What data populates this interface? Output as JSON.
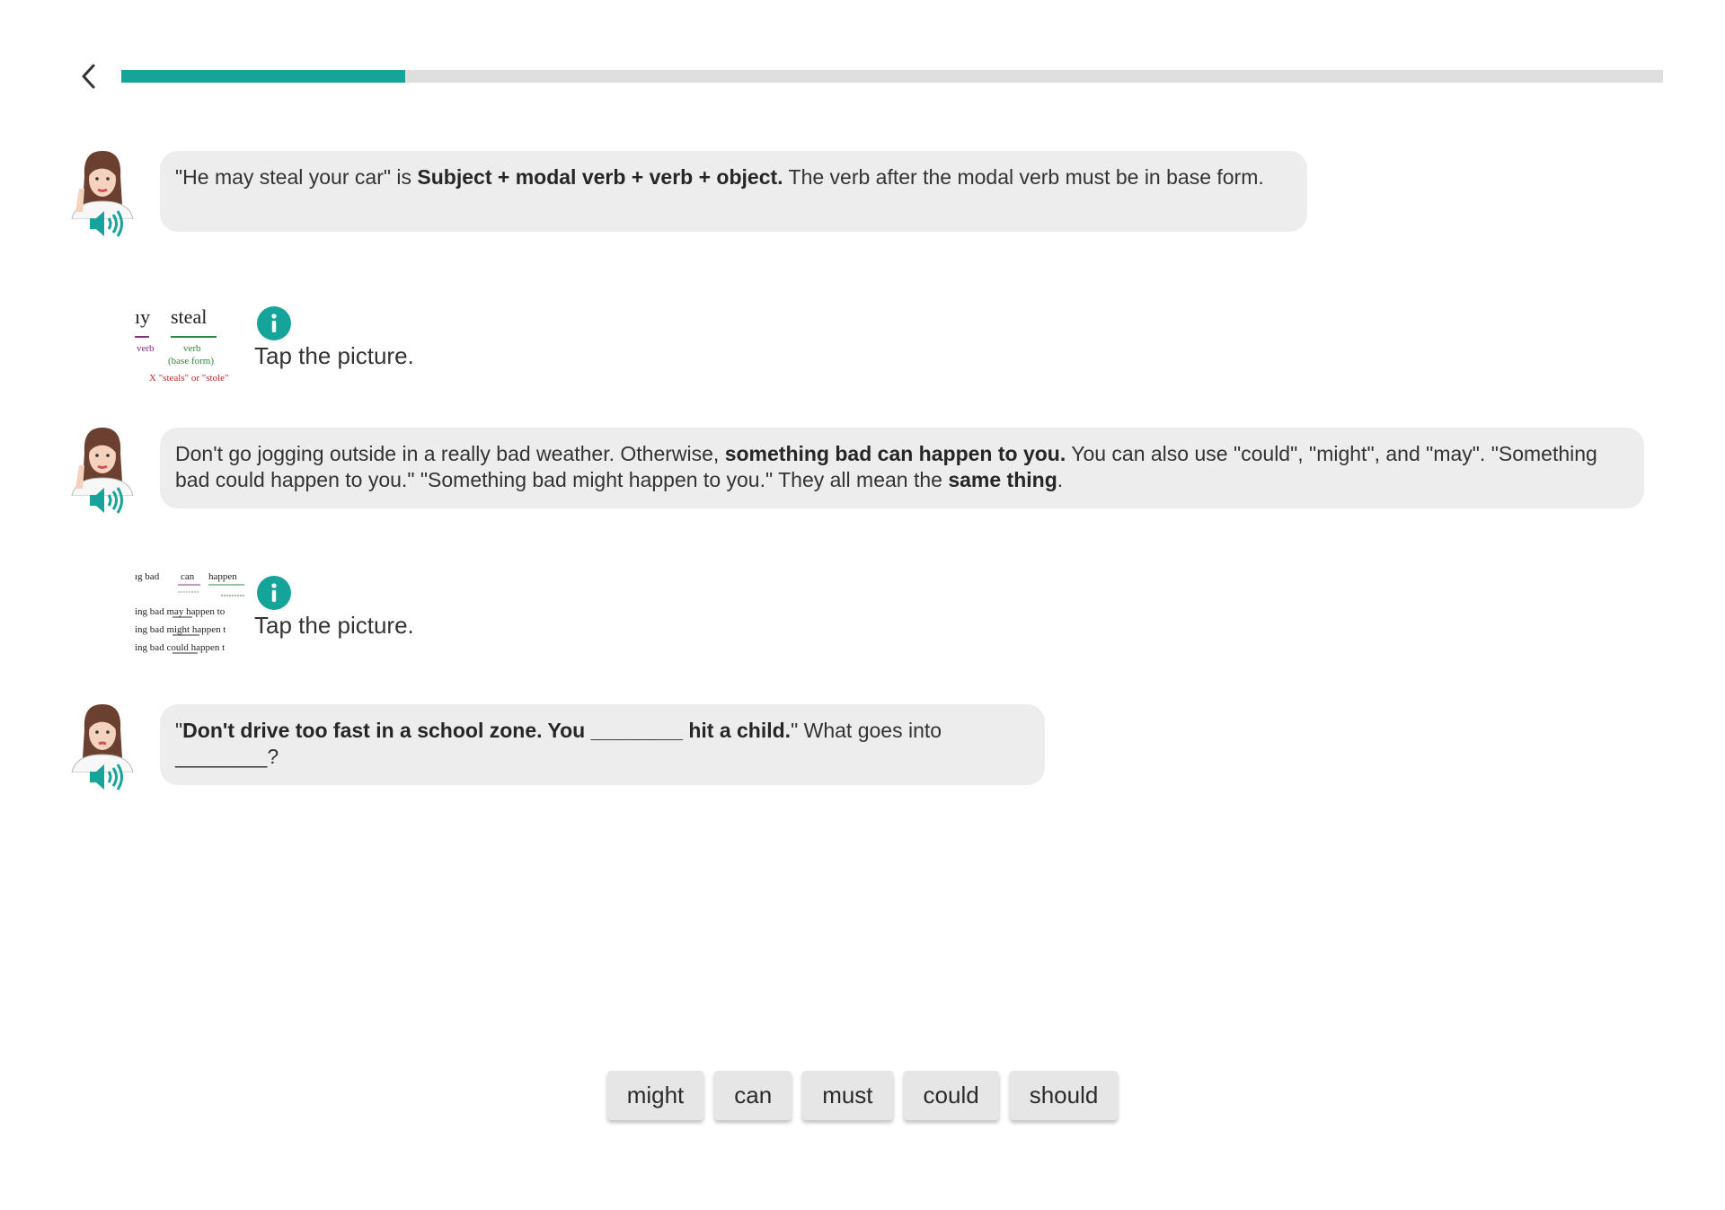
{
  "progress": {
    "fraction": 0.184
  },
  "colors": {
    "accent": "#15a39a",
    "bubble": "#ededed",
    "track": "#dedede"
  },
  "messages": [
    {
      "parts": [
        {
          "text": "\"He may steal your car\" is "
        },
        {
          "text": "Subject + modal verb + verb + object.",
          "bold": true
        },
        {
          "text": " The verb after the modal verb must be in base form."
        }
      ]
    },
    {
      "parts": [
        {
          "text": "Don't go jogging outside in a really bad weather. Otherwise, "
        },
        {
          "text": "something bad can happen to you.",
          "bold": true
        },
        {
          "text": " You can also use \"could\", \"might\", and \"may\". \"Something bad could happen to you.\" \"Something bad might happen to you.\" They all mean the "
        },
        {
          "text": "same thing",
          "bold": true
        },
        {
          "text": "."
        }
      ]
    },
    {
      "parts": [
        {
          "text": "\""
        },
        {
          "text": "Don't drive too fast in a school zone. You ________ hit a child.",
          "bold": true
        },
        {
          "text": "\" What goes into ________?"
        }
      ]
    }
  ],
  "pictures": [
    {
      "tap_text": "Tap the picture.",
      "thumb_labels": {
        "left_word": "ıy",
        "word": "steal",
        "left_sub": "verb",
        "sub1": "verb",
        "sub2": "(base form)",
        "note": "X \"steals\" or \"stole\""
      }
    },
    {
      "tap_text": "Tap the picture.",
      "thumb_labels": {
        "head": [
          "ıg bad",
          "can",
          "happen"
        ],
        "lines": [
          "ing bad may happen to",
          "ing bad might happen t",
          "ing bad could happen t"
        ]
      }
    }
  ],
  "answer_choices": [
    "might",
    "can",
    "must",
    "could",
    "should"
  ]
}
